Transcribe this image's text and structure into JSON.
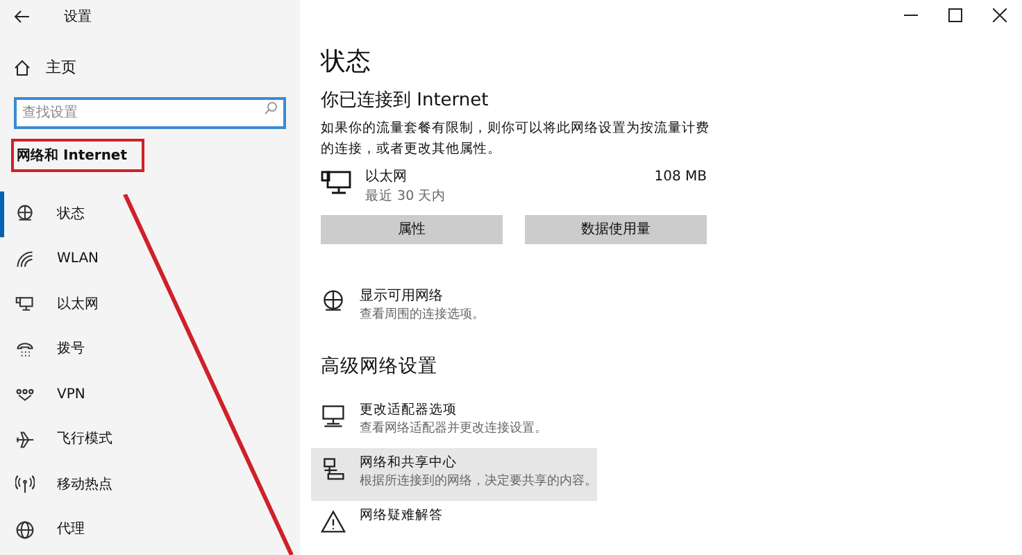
{
  "window": {
    "title": "设置"
  },
  "sidebar": {
    "home": "主页",
    "search": {
      "placeholder": "查找设置"
    },
    "section": "网络和 Internet",
    "items": [
      {
        "label": "状态",
        "selected": true
      },
      {
        "label": "WLAN",
        "selected": false
      },
      {
        "label": "以太网",
        "selected": false
      },
      {
        "label": "拨号",
        "selected": false
      },
      {
        "label": "VPN",
        "selected": false
      },
      {
        "label": "飞行模式",
        "selected": false
      },
      {
        "label": "移动热点",
        "selected": false
      },
      {
        "label": "代理",
        "selected": false
      }
    ]
  },
  "content": {
    "title": "状态",
    "connection": {
      "heading": "你已连接到 Internet",
      "description": "如果你的流量套餐有限制，则你可以将此网络设置为按流量计费的连接，或者更改其他属性。",
      "network": {
        "name": "以太网",
        "period": "最近 30 天内",
        "usage": "108 MB"
      },
      "buttons": [
        "属性",
        "数据使用量"
      ]
    },
    "show_networks": {
      "title": "显示可用网络",
      "subtitle": "查看周围的连接选项。"
    },
    "advanced_heading": "高级网络设置",
    "advanced_items": [
      {
        "title": "更改适配器选项",
        "subtitle": "查看网络适配器并更改连接设置。",
        "selected": false
      },
      {
        "title": "网络和共享中心",
        "subtitle": "根据所连接到的网络，决定要共享的内容。",
        "selected": true
      },
      {
        "title": "网络疑难解答",
        "selected": false
      }
    ]
  }
}
